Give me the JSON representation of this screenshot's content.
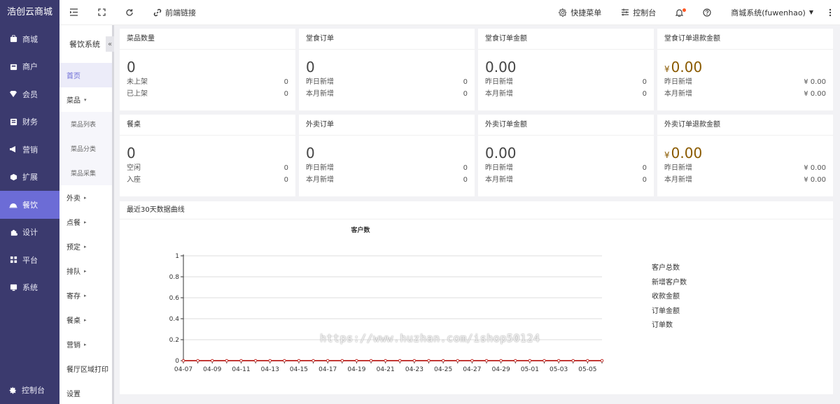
{
  "brand": "浩创云商城",
  "sidebar": {
    "items": [
      {
        "label": "商城",
        "icon": "store-icon"
      },
      {
        "label": "商户",
        "icon": "merchant-icon"
      },
      {
        "label": "会员",
        "icon": "member-icon"
      },
      {
        "label": "财务",
        "icon": "finance-icon"
      },
      {
        "label": "营销",
        "icon": "marketing-icon"
      },
      {
        "label": "扩展",
        "icon": "extension-icon"
      },
      {
        "label": "餐饮",
        "icon": "catering-icon"
      },
      {
        "label": "设计",
        "icon": "design-icon"
      },
      {
        "label": "平台",
        "icon": "platform-icon"
      },
      {
        "label": "系统",
        "icon": "system-icon"
      }
    ],
    "active_index": 6,
    "footer_label": "控制台"
  },
  "topbar": {
    "frontend_link": "前端链接",
    "quick_menu": "快捷菜单",
    "console": "控制台",
    "user": "商城系统(fuwenhao)"
  },
  "subnav": {
    "title": "餐饮系统",
    "collapse": "«",
    "items": [
      {
        "label": "首页",
        "type": "active"
      },
      {
        "label": "菜品",
        "type": "parent",
        "caret": "▾"
      },
      {
        "label": "菜品列表",
        "type": "child"
      },
      {
        "label": "菜品分类",
        "type": "child"
      },
      {
        "label": "菜品采集",
        "type": "child"
      },
      {
        "label": "外卖",
        "type": "parent",
        "caret": "▸"
      },
      {
        "label": "点餐",
        "type": "parent",
        "caret": "▸"
      },
      {
        "label": "预定",
        "type": "parent",
        "caret": "▸"
      },
      {
        "label": "排队",
        "type": "parent",
        "caret": "▸"
      },
      {
        "label": "寄存",
        "type": "parent",
        "caret": "▸"
      },
      {
        "label": "餐桌",
        "type": "parent",
        "caret": "▸"
      },
      {
        "label": "营销",
        "type": "parent",
        "caret": "▸"
      },
      {
        "label": "餐厅区域打印",
        "type": "plain"
      },
      {
        "label": "设置",
        "type": "plain"
      }
    ]
  },
  "cards": [
    {
      "title": "菜品数量",
      "value": "0",
      "rows": [
        [
          "未上架",
          "0"
        ],
        [
          "已上架",
          "0"
        ]
      ]
    },
    {
      "title": "堂食订单",
      "value": "0",
      "rows": [
        [
          "昨日新增",
          "0"
        ],
        [
          "本月新增",
          "0"
        ]
      ]
    },
    {
      "title": "堂食订单金额",
      "value": "0.00",
      "rows": [
        [
          "昨日新增",
          "0"
        ],
        [
          "本月新增",
          "0"
        ]
      ]
    },
    {
      "title": "堂食订单退款金额",
      "currency": "¥",
      "value": "0.00",
      "gold": true,
      "rows": [
        [
          "昨日新增",
          "¥ 0.00"
        ],
        [
          "本月新增",
          "¥ 0.00"
        ]
      ]
    },
    {
      "title": "餐桌",
      "value": "0",
      "rows": [
        [
          "空闲",
          "0"
        ],
        [
          "入座",
          "0"
        ]
      ]
    },
    {
      "title": "外卖订单",
      "value": "0",
      "rows": [
        [
          "昨日新增",
          "0"
        ],
        [
          "本月新增",
          "0"
        ]
      ]
    },
    {
      "title": "外卖订单金额",
      "value": "0.00",
      "rows": [
        [
          "昨日新增",
          "0"
        ],
        [
          "本月新增",
          "0"
        ]
      ]
    },
    {
      "title": "外卖订单退款金额",
      "currency": "¥",
      "value": "0.00",
      "gold": true,
      "rows": [
        [
          "昨日新增",
          "¥ 0.00"
        ],
        [
          "本月新增",
          "¥ 0.00"
        ]
      ]
    }
  ],
  "chart_section_title": "最近30天数据曲线",
  "watermark": "https://www.huzhan.com/ishop50124",
  "chart_data": {
    "type": "line",
    "title": "客户数",
    "x": [
      "04-07",
      "04-08",
      "04-09",
      "04-10",
      "04-11",
      "04-12",
      "04-13",
      "04-14",
      "04-15",
      "04-16",
      "04-17",
      "04-18",
      "04-19",
      "04-20",
      "04-21",
      "04-22",
      "04-23",
      "04-24",
      "04-25",
      "04-26",
      "04-27",
      "04-28",
      "04-29",
      "04-30",
      "05-01",
      "05-02",
      "05-03",
      "05-04",
      "05-05",
      "05-06"
    ],
    "x_tick_labels": [
      "04-07",
      "04-09",
      "04-11",
      "04-13",
      "04-15",
      "04-17",
      "04-19",
      "04-21",
      "04-23",
      "04-25",
      "04-27",
      "04-29",
      "05-01",
      "05-03",
      "05-05"
    ],
    "y_ticks": [
      "0",
      "0.2",
      "0.4",
      "0.6",
      "0.8",
      "1"
    ],
    "ylim": [
      0,
      1
    ],
    "grid": true,
    "legend_placement": "right",
    "line_color": "#c23531",
    "series": [
      {
        "name": "客户总数",
        "values": [
          0,
          0,
          0,
          0,
          0,
          0,
          0,
          0,
          0,
          0,
          0,
          0,
          0,
          0,
          0,
          0,
          0,
          0,
          0,
          0,
          0,
          0,
          0,
          0,
          0,
          0,
          0,
          0,
          0,
          0
        ]
      },
      {
        "name": "新增客户数",
        "values": [
          0,
          0,
          0,
          0,
          0,
          0,
          0,
          0,
          0,
          0,
          0,
          0,
          0,
          0,
          0,
          0,
          0,
          0,
          0,
          0,
          0,
          0,
          0,
          0,
          0,
          0,
          0,
          0,
          0,
          0
        ]
      },
      {
        "name": "收款金额",
        "values": [
          0,
          0,
          0,
          0,
          0,
          0,
          0,
          0,
          0,
          0,
          0,
          0,
          0,
          0,
          0,
          0,
          0,
          0,
          0,
          0,
          0,
          0,
          0,
          0,
          0,
          0,
          0,
          0,
          0,
          0
        ]
      },
      {
        "name": "订单金额",
        "values": [
          0,
          0,
          0,
          0,
          0,
          0,
          0,
          0,
          0,
          0,
          0,
          0,
          0,
          0,
          0,
          0,
          0,
          0,
          0,
          0,
          0,
          0,
          0,
          0,
          0,
          0,
          0,
          0,
          0,
          0
        ]
      },
      {
        "name": "订单数",
        "values": [
          0,
          0,
          0,
          0,
          0,
          0,
          0,
          0,
          0,
          0,
          0,
          0,
          0,
          0,
          0,
          0,
          0,
          0,
          0,
          0,
          0,
          0,
          0,
          0,
          0,
          0,
          0,
          0,
          0,
          0
        ]
      }
    ]
  }
}
